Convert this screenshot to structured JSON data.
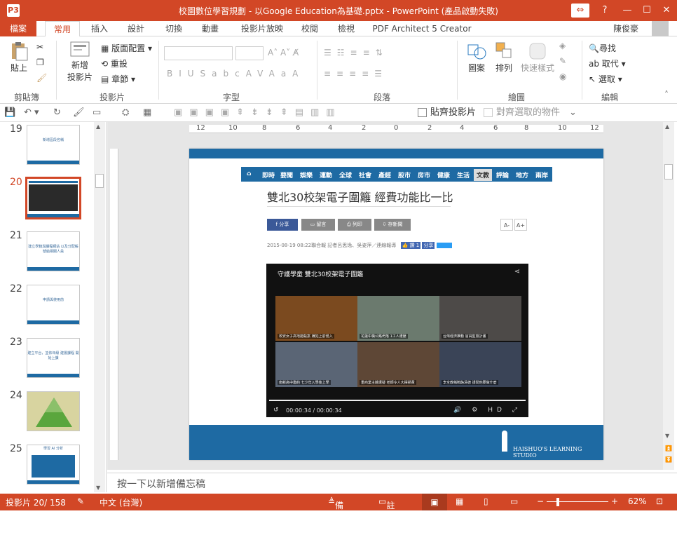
{
  "window": {
    "title": "校園數位學習規劃 - 以Google Education為基礎.pptx - PowerPoint (產品啟動失敗)",
    "app_icon": "P3"
  },
  "tabs": [
    {
      "label": "檔案",
      "kind": "file"
    },
    {
      "label": "常用",
      "kind": "active"
    },
    {
      "label": "插入"
    },
    {
      "label": "設計"
    },
    {
      "label": "切換"
    },
    {
      "label": "動畫"
    },
    {
      "label": "投影片放映"
    },
    {
      "label": "校閱"
    },
    {
      "label": "檢視"
    },
    {
      "label": "PDF Architect 5 Creator"
    }
  ],
  "user_name": "陳俊豪",
  "ribbon": {
    "clipboard": {
      "paste": "貼上",
      "group": "剪貼簿"
    },
    "slides": {
      "new_slide_1": "新增",
      "new_slide_2": "投影片",
      "layout": "版面配置",
      "reset": "重設",
      "section": "章節",
      "group": "投影片"
    },
    "font": {
      "group": "字型"
    },
    "paragraph": {
      "group": "段落"
    },
    "drawing": {
      "shapes": "圖案",
      "arrange": "排列",
      "quick_styles": "快速樣式",
      "group": "繪圖"
    },
    "editing": {
      "find": "尋找",
      "replace": "取代",
      "select": "選取",
      "group": "編輯"
    }
  },
  "qat": {
    "snap": "貼齊投影片",
    "align_selected": "對齊選取的物件"
  },
  "thumbnails": [
    {
      "num": "19",
      "caption": "新增區段名稱",
      "selected": false
    },
    {
      "num": "20",
      "caption": "",
      "selected": true
    },
    {
      "num": "21",
      "caption": "建立學籍與課程網站 以及分配帳號給相關人員",
      "selected": false
    },
    {
      "num": "22",
      "caption": "申請與使用前",
      "selected": false
    },
    {
      "num": "23",
      "caption": "建立平台，並依年級 建置課程 開始上課",
      "selected": false
    },
    {
      "num": "24",
      "caption": "",
      "selected": false
    },
    {
      "num": "25",
      "caption": "學習 AI 分析",
      "selected": false
    }
  ],
  "slide": {
    "nav_items": [
      "即時",
      "要聞",
      "娛樂",
      "運動",
      "全球",
      "社會",
      "產經",
      "股市",
      "房市",
      "健康",
      "生活",
      "文教",
      "評論",
      "地方",
      "兩岸"
    ],
    "nav_active": "文教",
    "headline": "雙北30校架電子圍籬 經費功能比一比",
    "share_buttons": [
      "分享",
      "留言",
      "列印",
      "存新聞"
    ],
    "font_buttons": [
      "A-",
      "A+"
    ],
    "meta": "2015-08-19 08:22聯合報 記者呂思逸、吳姿萍／連線報導",
    "like_label": "讚",
    "like_count": "1",
    "share_small": "分享",
    "video_title": "守護學童 雙北30校架電子圍籬",
    "video_time": "00:00:34 / 00:00:34",
    "video_captions": [
      "校安女子高地錯殺案 嫌犯上前侵入",
      "花蓮中橫公路坍落 1工人遭壓",
      "台灣經濟推動 官員監督計畫",
      "南新高中邀約 七少年入學後上學",
      "重商業主體遭疑 老師令人大揮掃黃",
      "李全教稱賄賂清德 請問他要做什麼"
    ],
    "footer_logo": "HAISHUO'S LEARNING STUDIO"
  },
  "ruler_labels": [
    "12",
    "10",
    "8",
    "6",
    "4",
    "2",
    "0",
    "2",
    "4",
    "6",
    "8",
    "10",
    "12"
  ],
  "notes_placeholder": "按一下以新增備忘稿",
  "status": {
    "slide_count": "投影片 20/ 158",
    "language": "中文 (台灣)",
    "notes": "備忘稿",
    "comments": "註解",
    "zoom": "62%"
  },
  "colors": {
    "accent": "#d24726",
    "slide_blue": "#1e6aa3"
  }
}
